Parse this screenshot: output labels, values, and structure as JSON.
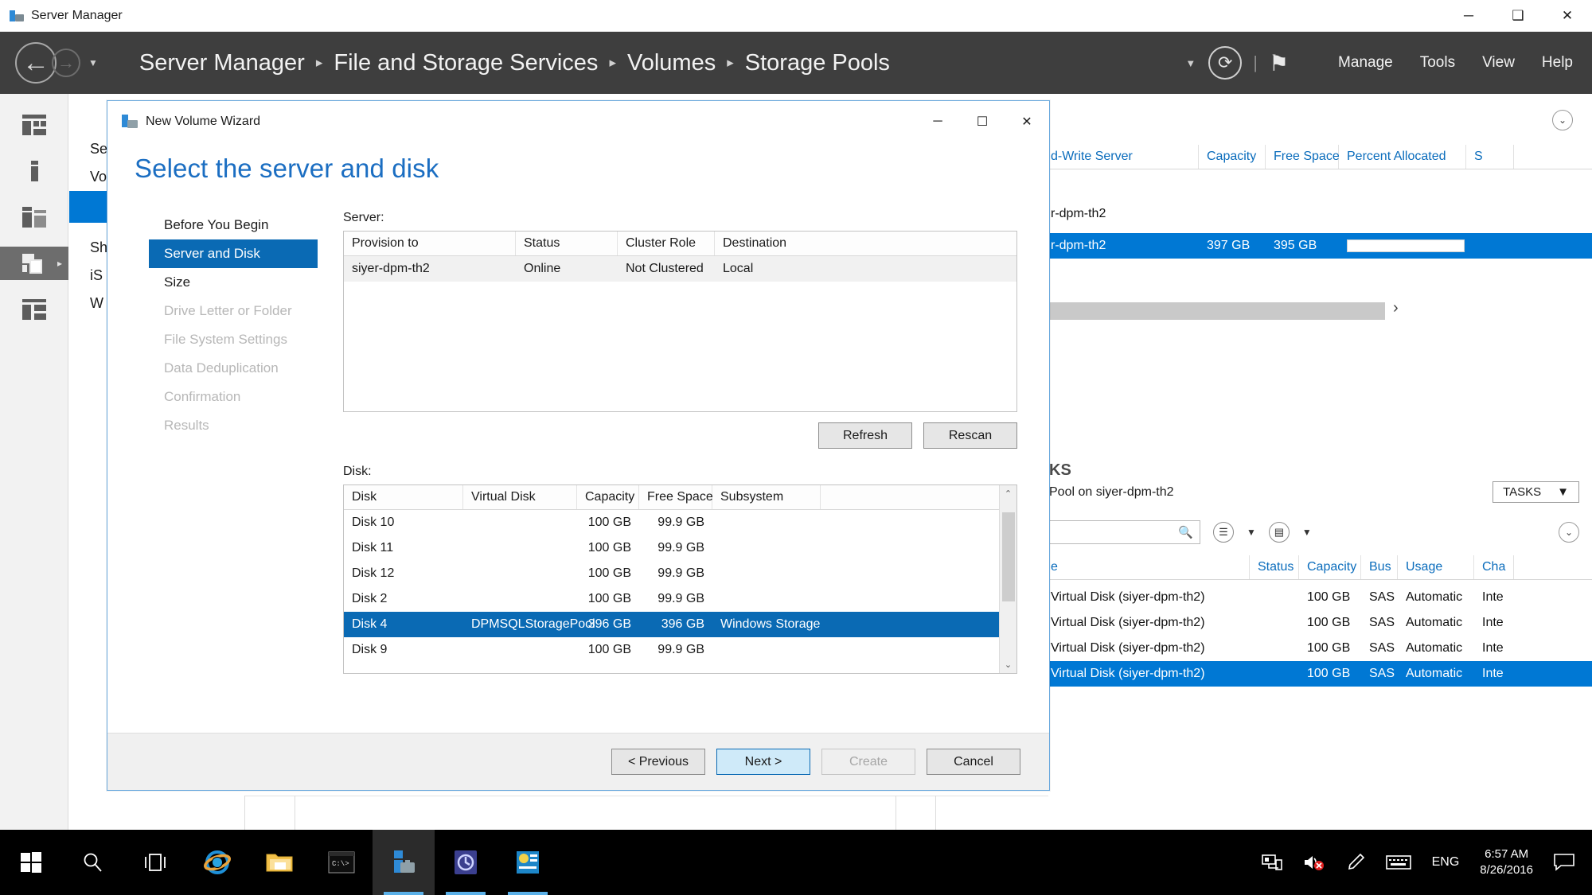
{
  "os_window": {
    "title": "Server Manager",
    "icon": "server-manager-icon",
    "minimize": "─",
    "maximize": "❑",
    "close": "✕"
  },
  "header": {
    "back_icon": "←",
    "forward_icon": "→",
    "dropdown_caret": "▼",
    "breadcrumb": [
      "Server Manager",
      "File and Storage Services",
      "Volumes",
      "Storage Pools"
    ],
    "breadcrumb_separator": "▸",
    "caret": "▼",
    "refresh_icon": "⟳",
    "pipe": "|",
    "flag_icon": "⚑",
    "menus": [
      "Manage",
      "Tools",
      "View",
      "Help"
    ]
  },
  "rail": {
    "items": [
      {
        "name": "dashboard-icon"
      },
      {
        "name": "local-server-icon"
      },
      {
        "name": "all-servers-icon"
      },
      {
        "name": "file-and-storage-services-icon",
        "selected": true,
        "arrow": "▸"
      },
      {
        "name": "iscsi-icon"
      }
    ]
  },
  "bgnav": {
    "items": [
      {
        "label": "Se",
        "selected": false
      },
      {
        "label": "Vo",
        "selected": false
      },
      {
        "label": "",
        "selected": true
      },
      {
        "label": "Sh",
        "selected": false
      },
      {
        "label": "iS",
        "selected": false
      },
      {
        "label": "W",
        "selected": false
      }
    ]
  },
  "background": {
    "volumes_panel": {
      "chevron": "⌄",
      "columns": [
        "d-Write Server",
        "Capacity",
        "Free Space",
        "Percent Allocated",
        "S"
      ],
      "rows": [
        {
          "server": "r-dpm-th2",
          "capacity": "",
          "free": "",
          "percent": "",
          "s": "",
          "selected": false
        },
        {
          "server": "r-dpm-th2",
          "capacity": "397 GB",
          "free": "395 GB",
          "percent": "",
          "s": "",
          "selected": true
        }
      ],
      "scroll_right_arrow": "›"
    },
    "pool_panel": {
      "title_fragment": "KS",
      "subtitle_fragment": "Pool on siyer-dpm-th2",
      "tasks_label": "TASKS",
      "tasks_caret": "▼",
      "search_icon": "search-icon",
      "list_icon": "☰",
      "save_icon": "▤",
      "caret": "▼",
      "chevron": "⌄",
      "columns": [
        "e",
        "Status",
        "Capacity",
        "Bus",
        "Usage",
        "Cha"
      ],
      "rows": [
        {
          "name": "Virtual Disk (siyer-dpm-th2)",
          "status": "",
          "capacity": "100 GB",
          "bus": "SAS",
          "usage": "Automatic",
          "cha": "Inte",
          "selected": false
        },
        {
          "name": "Virtual Disk (siyer-dpm-th2)",
          "status": "",
          "capacity": "100 GB",
          "bus": "SAS",
          "usage": "Automatic",
          "cha": "Inte",
          "selected": false
        },
        {
          "name": "Virtual Disk (siyer-dpm-th2)",
          "status": "",
          "capacity": "100 GB",
          "bus": "SAS",
          "usage": "Automatic",
          "cha": "Inte",
          "selected": false
        },
        {
          "name": "Virtual Disk (siyer-dpm-th2)",
          "status": "",
          "capacity": "100 GB",
          "bus": "SAS",
          "usage": "Automatic",
          "cha": "Inte",
          "selected": true
        }
      ]
    }
  },
  "wizard": {
    "title": "New Volume Wizard",
    "title_icon": "wizard-icon",
    "minimize": "─",
    "maximize": "☐",
    "close": "✕",
    "heading": "Select the server and disk",
    "nav": [
      {
        "label": "Before You Begin",
        "state": "done"
      },
      {
        "label": "Server and Disk",
        "state": "selected"
      },
      {
        "label": "Size",
        "state": "done"
      },
      {
        "label": "Drive Letter or Folder",
        "state": "disabled"
      },
      {
        "label": "File System Settings",
        "state": "disabled"
      },
      {
        "label": "Data Deduplication",
        "state": "disabled"
      },
      {
        "label": "Confirmation",
        "state": "disabled"
      },
      {
        "label": "Results",
        "state": "disabled"
      }
    ],
    "server_section": {
      "label": "Server:",
      "columns": [
        "Provision to",
        "Status",
        "Cluster Role",
        "Destination"
      ],
      "rows": [
        {
          "provision_to": "siyer-dpm-th2",
          "status": "Online",
          "cluster_role": "Not Clustered",
          "destination": "Local"
        }
      ],
      "refresh_button": "Refresh",
      "rescan_button": "Rescan"
    },
    "disk_section": {
      "label": "Disk:",
      "columns": [
        "Disk",
        "Virtual Disk",
        "Capacity",
        "Free Space",
        "Subsystem"
      ],
      "rows": [
        {
          "disk": "Disk 10",
          "virtual_disk": "",
          "capacity": "100 GB",
          "free_space": "99.9 GB",
          "subsystem": "",
          "selected": false
        },
        {
          "disk": "Disk 11",
          "virtual_disk": "",
          "capacity": "100 GB",
          "free_space": "99.9 GB",
          "subsystem": "",
          "selected": false
        },
        {
          "disk": "Disk 12",
          "virtual_disk": "",
          "capacity": "100 GB",
          "free_space": "99.9 GB",
          "subsystem": "",
          "selected": false
        },
        {
          "disk": "Disk 2",
          "virtual_disk": "",
          "capacity": "100 GB",
          "free_space": "99.9 GB",
          "subsystem": "",
          "selected": false
        },
        {
          "disk": "Disk 4",
          "virtual_disk": "DPMSQLStoragePool",
          "capacity": "396 GB",
          "free_space": "396 GB",
          "subsystem": "Windows Storage",
          "selected": true
        },
        {
          "disk": "Disk 9",
          "virtual_disk": "",
          "capacity": "100 GB",
          "free_space": "99.9 GB",
          "subsystem": "",
          "selected": false
        }
      ],
      "scroll_up": "⌃",
      "scroll_down": "⌄"
    },
    "footer": {
      "previous": "< Previous",
      "next": "Next >",
      "create": "Create",
      "cancel": "Cancel"
    }
  },
  "taskbar": {
    "items": [
      {
        "name": "start-button-icon"
      },
      {
        "name": "search-icon"
      },
      {
        "name": "task-view-icon"
      },
      {
        "name": "internet-explorer-icon"
      },
      {
        "name": "file-explorer-icon"
      },
      {
        "name": "command-prompt-icon"
      },
      {
        "name": "server-manager-icon"
      },
      {
        "name": "backup-app-icon"
      },
      {
        "name": "dashboard-app-icon"
      }
    ],
    "tray": {
      "network_icon": "network-icon",
      "volume_icon": "volume-muted-icon",
      "pen_icon": "pen-icon",
      "keyboard_icon": "keyboard-icon",
      "language": "ENG",
      "time": "6:57 AM",
      "date": "8/26/2016",
      "action_center_icon": "action-center-icon"
    }
  },
  "colors": {
    "accent": "#0078d4",
    "wizard_accent": "#0a6ab4",
    "header_bg": "#3e3e3e",
    "heading_blue": "#1b6ec2"
  }
}
